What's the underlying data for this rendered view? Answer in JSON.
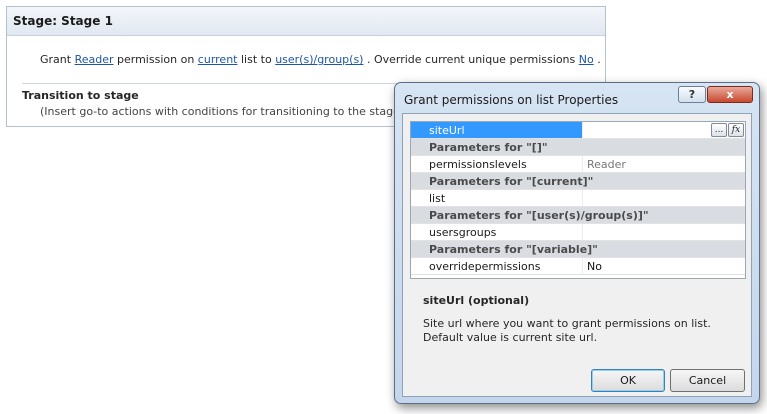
{
  "stage": {
    "title": "Stage: Stage 1",
    "action": {
      "t1": "Grant",
      "reader_link": "Reader",
      "t2": "permission on",
      "current_link": "current",
      "t3": "list to",
      "users_link": "user(s)/group(s)",
      "t4": ". Override current unique permissions",
      "no_link": "No",
      "t5": "."
    },
    "transition_title": "Transition to stage",
    "transition_hint": "(Insert go-to actions with conditions for transitioning to the stage)"
  },
  "dialog": {
    "title": "Grant permissions on list Properties",
    "help_label": "?",
    "close_label": "x",
    "grid": {
      "siteurl_name": "siteUrl",
      "browse_label": "...",
      "fx_label": "fx",
      "header_1": "Parameters for \"[]\"",
      "permissionslevels_name": "permissionslevels",
      "permissionslevels_value": "Reader",
      "header_2": "Parameters for \"[current]\"",
      "list_name": "list",
      "header_3": "Parameters for \"[user(s)/group(s)]\"",
      "usersgroups_name": "usersgroups",
      "header_4": "Parameters for \"[variable]\"",
      "overridepermissions_name": "overridepermissions",
      "overridepermissions_value": "No"
    },
    "description_title": "siteUrl (optional)",
    "description_text": "Site url where you want to grant permissions on list. Default value is current site url.",
    "ok_label": "OK",
    "cancel_label": "Cancel"
  }
}
